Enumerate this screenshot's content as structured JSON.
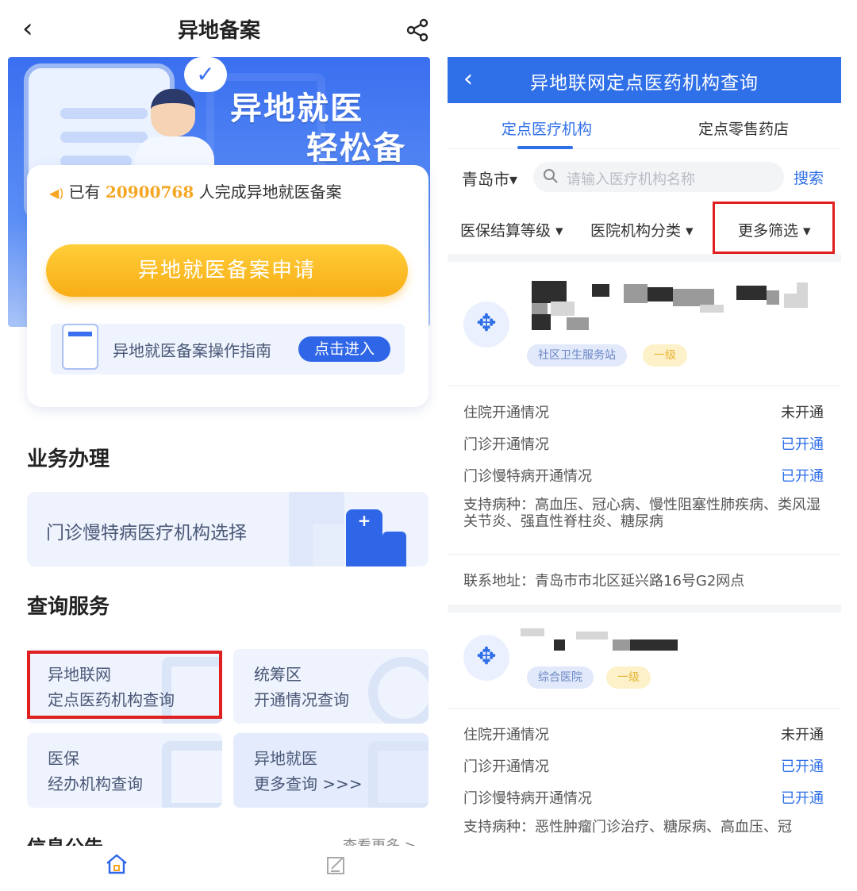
{
  "left": {
    "title": "异地备案",
    "back_glyph": "‹",
    "banner": {
      "line1": "异地就医",
      "line2": "轻松备案",
      "bubble_glyph": "✓"
    },
    "count": {
      "prefix": "已有",
      "number": "20900768",
      "suffix": "人完成异地就医备案"
    },
    "apply_button": "异地就医备案申请",
    "guide": {
      "label": "异地就医备案操作指南",
      "button": "点击进入"
    },
    "business": {
      "title": "业务办理",
      "item": "门诊慢特病医疗机构选择"
    },
    "query": {
      "title": "查询服务",
      "items": [
        {
          "line1": "异地联网",
          "line2": "定点医药机构查询"
        },
        {
          "line1": "统筹区",
          "line2": "开通情况查询"
        },
        {
          "line1": "医保",
          "line2": "经办机构查询"
        },
        {
          "line1": "异地就医",
          "line2": "更多查询 >>>"
        }
      ]
    },
    "notice": {
      "title": "信息公告",
      "more": "查看更多 >"
    },
    "icons": {
      "home": "home-icon",
      "edit": "edit-icon",
      "share": "share-icon"
    },
    "colors": {
      "primary": "#2f66e8",
      "accent": "#f8ad15",
      "highlight": "#e02020"
    }
  },
  "right": {
    "title": "异地联网定点医药机构查询",
    "back_glyph": "‹",
    "tabs": [
      "定点医疗机构",
      "定点零售药店"
    ],
    "city": "青岛市▾",
    "search_placeholder": "请输入医疗机构名称",
    "search_button": "搜索",
    "filters": [
      "医保结算等级 ▾",
      "医院机构分类 ▾",
      "更多筛选 ▾"
    ],
    "institutions": [
      {
        "tags": [
          "社区卫生服务站",
          "一级"
        ],
        "rows": [
          {
            "label": "住院开通情况",
            "value": "未开通"
          },
          {
            "label": "门诊开通情况",
            "value": "已开通"
          },
          {
            "label": "门诊慢特病开通情况",
            "value": "已开通"
          }
        ],
        "disease": "支持病种：高血压、冠心病、慢性阻塞性肺疾病、类风湿关节炎、强直性脊柱炎、糖尿病",
        "address": "联系地址：青岛市市北区延兴路16号G2网点"
      },
      {
        "tags": [
          "综合医院",
          "一级"
        ],
        "rows": [
          {
            "label": "住院开通情况",
            "value": "未开通"
          },
          {
            "label": "门诊开通情况",
            "value": "已开通"
          },
          {
            "label": "门诊慢特病开通情况",
            "value": "已开通"
          }
        ],
        "disease": "支持病种：恶性肿瘤门诊治疗、糖尿病、高血压、冠"
      }
    ]
  }
}
